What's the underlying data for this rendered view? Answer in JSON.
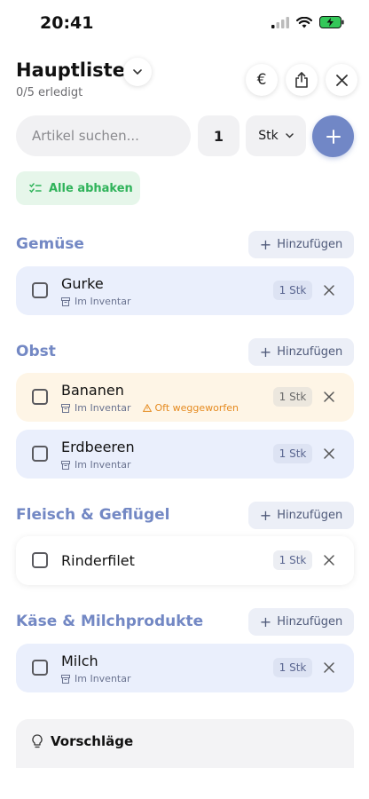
{
  "status": {
    "time": "20:41"
  },
  "header": {
    "title": "Hauptliste",
    "subtitle": "0/5 erledigt"
  },
  "toolbar": {
    "currency_icon": "euro-icon",
    "share_icon": "share-icon",
    "close_icon": "close-icon"
  },
  "search": {
    "placeholder": "Artikel suchen...",
    "quantity": "1",
    "unit": "Stk"
  },
  "check_all_label": "Alle abhaken",
  "add_label": "Hinzufügen",
  "sections": [
    {
      "title": "Gemüse",
      "items": [
        {
          "name": "Gurke",
          "meta": "Im Inventar",
          "qty": "1 Stk"
        }
      ]
    },
    {
      "title": "Obst",
      "items": [
        {
          "name": "Bananen",
          "meta": "Im Inventar",
          "warning": "Oft weggeworfen",
          "qty": "1 Stk"
        },
        {
          "name": "Erdbeeren",
          "meta": "Im Inventar",
          "qty": "1 Stk"
        }
      ]
    },
    {
      "title": "Fleisch & Geflügel",
      "items": [
        {
          "name": "Rinderfilet",
          "qty": "1 Stk"
        }
      ]
    },
    {
      "title": "Käse & Milchprodukte",
      "items": [
        {
          "name": "Milch",
          "meta": "Im Inventar",
          "qty": "1 Stk"
        }
      ]
    }
  ],
  "suggestions": {
    "title": "Vorschläge"
  },
  "colors": {
    "accent": "#7187c6",
    "section_title": "#7388c4",
    "success": "#2fb35a",
    "warning": "#e58a1f"
  }
}
